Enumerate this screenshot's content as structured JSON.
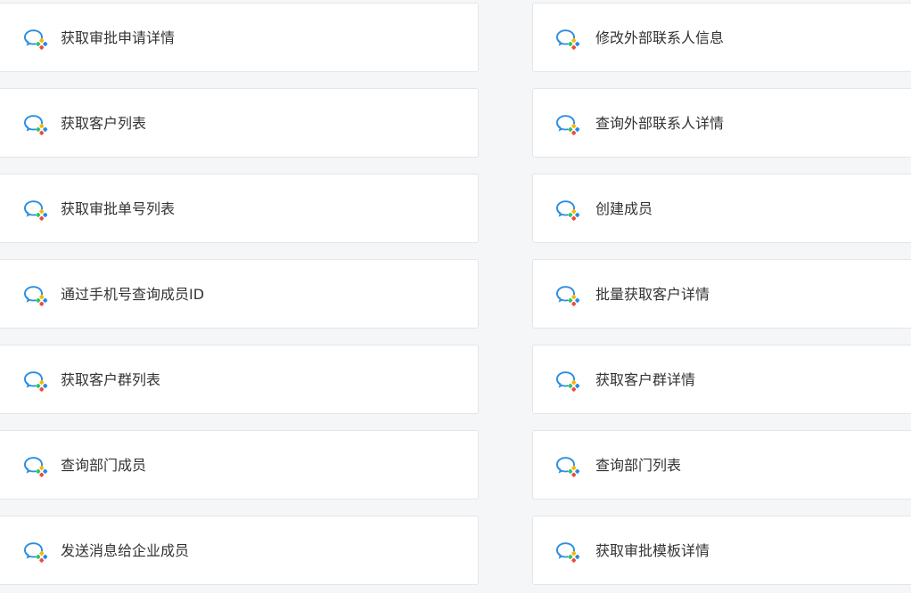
{
  "grid": {
    "left": [
      {
        "label": "获取审批申请详情"
      },
      {
        "label": "获取客户列表"
      },
      {
        "label": "获取审批单号列表"
      },
      {
        "label": "通过手机号查询成员ID"
      },
      {
        "label": "获取客户群列表"
      },
      {
        "label": "查询部门成员"
      },
      {
        "label": "发送消息给企业成员"
      }
    ],
    "right": [
      {
        "label": "修改外部联系人信息"
      },
      {
        "label": "查询外部联系人详情"
      },
      {
        "label": "创建成员"
      },
      {
        "label": "批量获取客户详情"
      },
      {
        "label": "获取客户群详情"
      },
      {
        "label": "查询部门列表"
      },
      {
        "label": "获取审批模板详情"
      }
    ]
  },
  "icon": {
    "name": "wecom-chat-icon",
    "colors": {
      "bubble": "#2a8ee0",
      "yellow": "#f6b800",
      "green": "#34c36a",
      "blue": "#1f8cf0",
      "red": "#f04a3a"
    }
  }
}
